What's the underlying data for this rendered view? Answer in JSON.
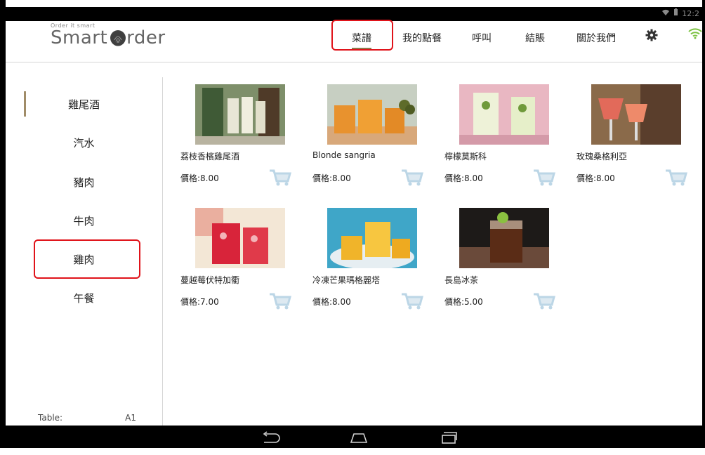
{
  "status": {
    "time": "12:2"
  },
  "brand": {
    "tagline": "Order it smart",
    "name_prefix": "Smart ",
    "name_suffix": "rder"
  },
  "nav": {
    "menu": "菜譜",
    "my_order": "我的點餐",
    "call": "呼叫",
    "checkout": "結賬",
    "about": "關於我們"
  },
  "categories": [
    "雞尾酒",
    "汽水",
    "豬肉",
    "牛肉",
    "雞肉",
    "午餐"
  ],
  "table": {
    "label": "Table:",
    "value": "A1"
  },
  "items": [
    {
      "name": "荔枝香檳雞尾酒",
      "price": "價格:8.00"
    },
    {
      "name": "Blonde sangria",
      "price": "價格:8.00"
    },
    {
      "name": "檸檬莫斯科",
      "price": "價格:8.00"
    },
    {
      "name": "玫瑰桑格利亞",
      "price": "價格:8.00"
    },
    {
      "name": "蔓越莓伏特加衢",
      "price": "價格:7.00"
    },
    {
      "name": "冷凍芒果瑪格麗塔",
      "price": "價格:8.00"
    },
    {
      "name": "長島冰茶",
      "price": "價格:5.00"
    }
  ],
  "colors": {
    "highlight": "#e0131a",
    "accent": "#8b7a4e",
    "cart": "#bcd6e6",
    "wifi": "#7cc242"
  }
}
